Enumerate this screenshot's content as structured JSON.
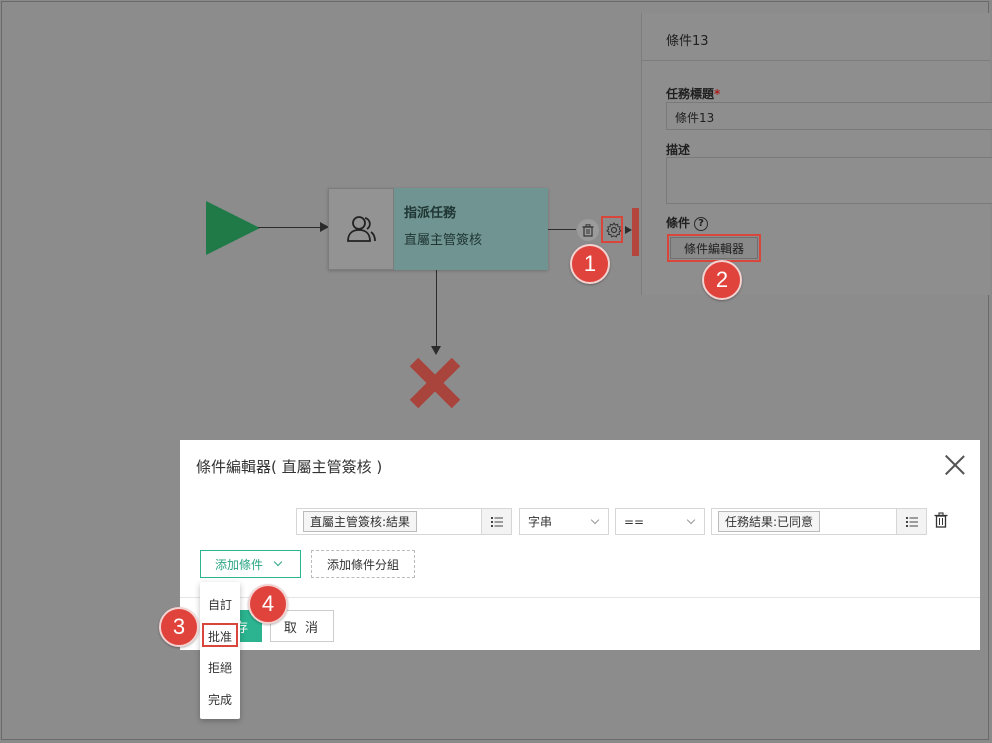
{
  "workflow": {
    "task": {
      "title": "指派任務",
      "subtitle": "直屬主管簽核"
    }
  },
  "badges": [
    "1",
    "2",
    "3",
    "4"
  ],
  "side_panel": {
    "header": "條件13",
    "task_title_label": "任務標題",
    "required_mark": "*",
    "task_title_value": "條件13",
    "description_label": "描述",
    "condition_label": "條件",
    "help_glyph": "?",
    "condition_editor_button": "條件編輯器"
  },
  "dialog": {
    "title": "條件編輯器( 直屬主管簽核 )",
    "row": {
      "field": "直屬主管簽核:結果",
      "type": "字串",
      "operator": "==",
      "value": "任務結果:已同意"
    },
    "add_condition": "添加條件",
    "add_condition_group": "添加條件分組",
    "save": "存",
    "cancel": "取 消"
  },
  "add_condition_menu": [
    "自訂",
    "批准",
    "拒絕",
    "完成"
  ],
  "colors": {
    "accent": "#2bb48f",
    "highlight": "#d8453a",
    "badge": "#e0433b"
  }
}
